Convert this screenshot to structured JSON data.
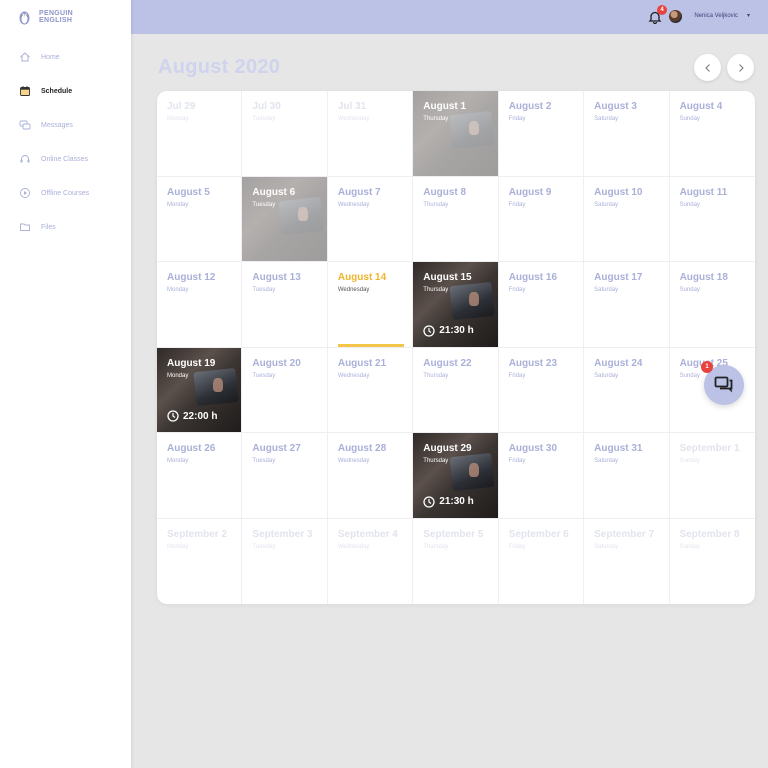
{
  "brand": {
    "line1": "PENGUIN",
    "line2": "ENGLISH"
  },
  "sidebar": {
    "items": [
      {
        "label": "Home",
        "icon": "home-icon",
        "active": false
      },
      {
        "label": "Schedule",
        "icon": "calendar-icon",
        "active": true
      },
      {
        "label": "Messages",
        "icon": "chat-icon",
        "active": false
      },
      {
        "label": "Online Classes",
        "icon": "headset-icon",
        "active": false
      },
      {
        "label": "Offline Courses",
        "icon": "play-circle-icon",
        "active": false
      },
      {
        "label": "Files",
        "icon": "folder-icon",
        "active": false
      }
    ]
  },
  "topbar": {
    "notifications_count": "4",
    "user_name": "Nenica Veljkovic",
    "caret": "▾"
  },
  "calendar": {
    "month_title": "August 2020",
    "days": [
      {
        "date": "Jul 29",
        "weekday": "Monday",
        "state": "muted"
      },
      {
        "date": "Jul 30",
        "weekday": "Tuesday",
        "state": "muted"
      },
      {
        "date": "Jul 31",
        "weekday": "Wednesday",
        "state": "muted"
      },
      {
        "date": "August 1",
        "weekday": "Thursday",
        "state": "photo-faded"
      },
      {
        "date": "August 2",
        "weekday": "Friday",
        "state": "normal"
      },
      {
        "date": "August 3",
        "weekday": "Saturday",
        "state": "normal"
      },
      {
        "date": "August 4",
        "weekday": "Sunday",
        "state": "normal"
      },
      {
        "date": "August 5",
        "weekday": "Monday",
        "state": "normal"
      },
      {
        "date": "August 6",
        "weekday": "Tuesday",
        "state": "photo-faded"
      },
      {
        "date": "August 7",
        "weekday": "Wednesday",
        "state": "normal"
      },
      {
        "date": "August 8",
        "weekday": "Thursday",
        "state": "normal"
      },
      {
        "date": "August 9",
        "weekday": "Friday",
        "state": "normal"
      },
      {
        "date": "August 10",
        "weekday": "Saturday",
        "state": "normal"
      },
      {
        "date": "August 11",
        "weekday": "Sunday",
        "state": "normal"
      },
      {
        "date": "August 12",
        "weekday": "Monday",
        "state": "normal"
      },
      {
        "date": "August 13",
        "weekday": "Tuesday",
        "state": "normal"
      },
      {
        "date": "August 14",
        "weekday": "Wednesday",
        "state": "today"
      },
      {
        "date": "August 15",
        "weekday": "Thursday",
        "state": "photo",
        "time": "21:30 h"
      },
      {
        "date": "August 16",
        "weekday": "Friday",
        "state": "normal"
      },
      {
        "date": "August 17",
        "weekday": "Saturday",
        "state": "normal"
      },
      {
        "date": "August 18",
        "weekday": "Sunday",
        "state": "normal"
      },
      {
        "date": "August 19",
        "weekday": "Monday",
        "state": "photo",
        "time": "22:00 h"
      },
      {
        "date": "August 20",
        "weekday": "Tuesday",
        "state": "normal"
      },
      {
        "date": "August 21",
        "weekday": "Wednesday",
        "state": "normal"
      },
      {
        "date": "August 22",
        "weekday": "Thursday",
        "state": "normal"
      },
      {
        "date": "August 23",
        "weekday": "Friday",
        "state": "normal"
      },
      {
        "date": "August 24",
        "weekday": "Saturday",
        "state": "normal"
      },
      {
        "date": "August 25",
        "weekday": "Sunday",
        "state": "normal"
      },
      {
        "date": "August 26",
        "weekday": "Monday",
        "state": "normal"
      },
      {
        "date": "August 27",
        "weekday": "Tuesday",
        "state": "normal"
      },
      {
        "date": "August 28",
        "weekday": "Wednesday",
        "state": "normal"
      },
      {
        "date": "August 29",
        "weekday": "Thursday",
        "state": "photo",
        "time": "21:30 h"
      },
      {
        "date": "August 30",
        "weekday": "Friday",
        "state": "normal"
      },
      {
        "date": "August 31",
        "weekday": "Saturday",
        "state": "normal"
      },
      {
        "date": "September 1",
        "weekday": "Sunday",
        "state": "muted"
      },
      {
        "date": "September 2",
        "weekday": "Monday",
        "state": "muted"
      },
      {
        "date": "September 3",
        "weekday": "Tuesday",
        "state": "muted"
      },
      {
        "date": "September 4",
        "weekday": "Wednesday",
        "state": "muted"
      },
      {
        "date": "September 5",
        "weekday": "Thursday",
        "state": "muted"
      },
      {
        "date": "September 6",
        "weekday": "Friday",
        "state": "muted"
      },
      {
        "date": "September 7",
        "weekday": "Saturday",
        "state": "muted"
      },
      {
        "date": "September 8",
        "weekday": "Sunday",
        "state": "muted"
      }
    ]
  },
  "chat": {
    "badge_count": "1"
  },
  "colors": {
    "accent": "#bcc2e6",
    "text_muted": "#aab0d8",
    "today": "#f0b52c",
    "badge": "#e8423f"
  }
}
